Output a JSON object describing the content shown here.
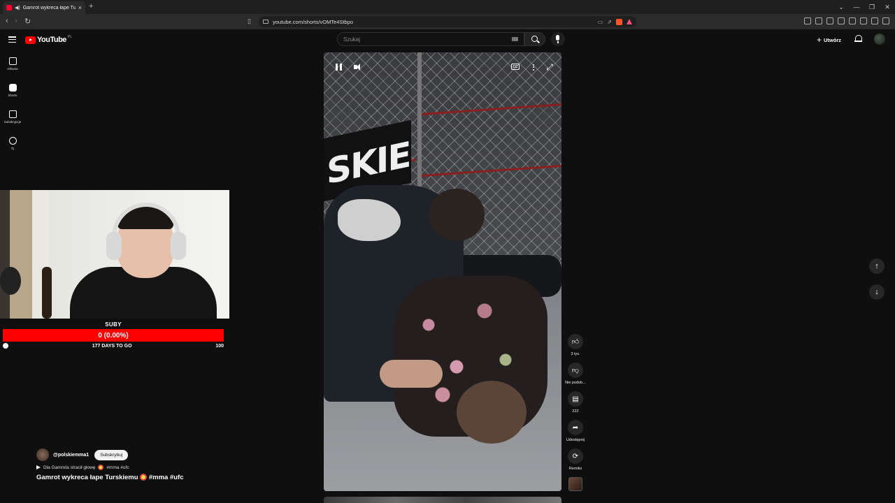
{
  "browser": {
    "tab_title": "Gamrot wykreca łape Turskie",
    "url": "youtube.com/shorts/vOMTe4Stbpo"
  },
  "masthead": {
    "logo_text": "YouTube",
    "logo_country": "PL",
    "search_placeholder": "Szukaj",
    "create_label": "Utwórz"
  },
  "guide": {
    "items": [
      {
        "label": "Główna",
        "icon": "home-icon"
      },
      {
        "label": "Shorts",
        "icon": "shorts-icon"
      },
      {
        "label": "Subskrypcje",
        "icon": "subscriptions-icon"
      },
      {
        "label": "Ty",
        "icon": "you-icon"
      }
    ]
  },
  "goal": {
    "label": "SUBY",
    "bar_text": "0 (0.00%)",
    "progress_fraction": 0.0,
    "start": "0",
    "days_left": "177 DAYS TO GO",
    "target": "100",
    "bar_color": "#ff0000"
  },
  "video": {
    "banner_text": "SKIE"
  },
  "actions": {
    "like_count": "3 tys.",
    "dislike_label": "Nie podob...",
    "comment_count": "222",
    "share_label": "Udostępnij",
    "remix_label": "Remiks"
  },
  "meta": {
    "channel": "@polskiemma1",
    "subscribe_label": "Subskrybuj",
    "sound_text": "Dla Gamrota stracił głowę",
    "sound_tags": "#mma #ufc",
    "title": "Gamrot wykreca łape Turskiemu",
    "title_tags": "#mma #ufc"
  }
}
